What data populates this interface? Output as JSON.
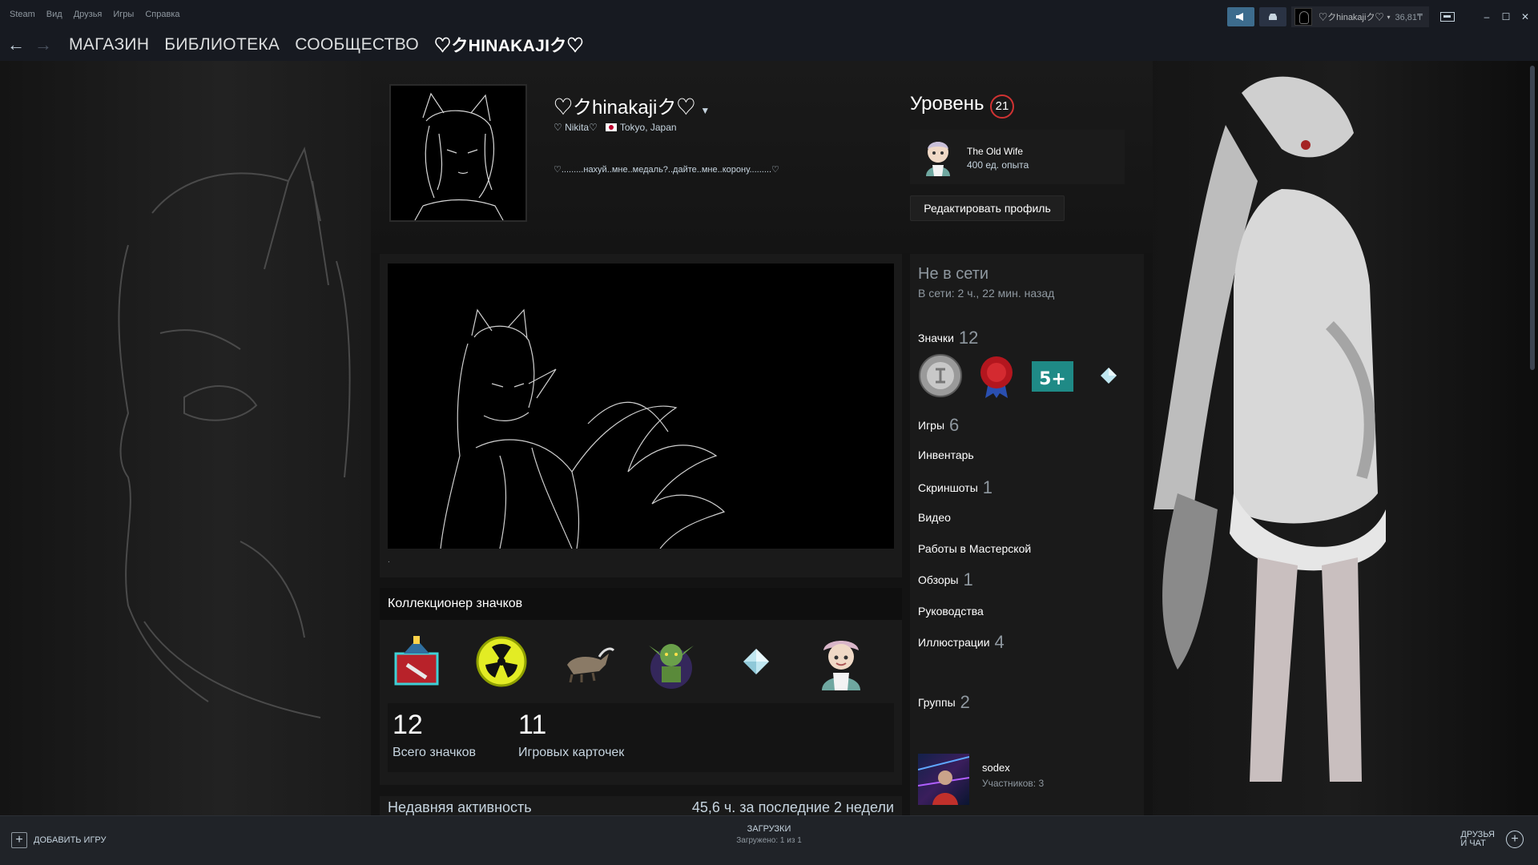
{
  "menu": [
    "Steam",
    "Вид",
    "Друзья",
    "Игры",
    "Справка"
  ],
  "account": {
    "name": "♡クhinakajiク♡",
    "balance": "36,81₸"
  },
  "nav": {
    "store": "МАГАЗИН",
    "library": "БИБЛИОТЕКА",
    "community": "СООБЩЕСТВО",
    "user": "♡クHINAKAJIク♡"
  },
  "profile": {
    "name": "♡クhinakajiク♡",
    "real_name": "♡ Nikita♡",
    "location": "Tokyo, Japan",
    "summary": "♡.........нахуй..мне..медаль?..дайте..мне..корону.........♡"
  },
  "level": {
    "label": "Уровень",
    "value": "21"
  },
  "favorite_badge": {
    "name": "The Old Wife",
    "xp": "400 ед. опыта"
  },
  "edit_profile": "Редактировать профиль",
  "showcase_caption": ".",
  "collector": {
    "title": "Коллекционер значков",
    "badges": [
      "toolbox-badge-icon",
      "radiation-badge-icon",
      "goat-badge-icon",
      "goblin-badge-icon",
      "crystal-badge-icon",
      "old-wife-badge-icon"
    ],
    "total_badges": "12",
    "total_badges_label": "Всего значков",
    "game_cards": "11",
    "game_cards_label": "Игровых карточек"
  },
  "recent": {
    "label": "Недавняя активность",
    "hours": "45,6 ч. за последние 2 недели"
  },
  "sidebar": {
    "status": "Не в сети",
    "last_online": "В сети: 2 ч., 22 мин. назад",
    "badges_label": "Значки",
    "badges_count": "12",
    "games_label": "Игры",
    "games_count": "6",
    "inventory": "Инвентарь",
    "screenshots_label": "Скриншоты",
    "screenshots_count": "1",
    "videos": "Видео",
    "workshop": "Работы в Мастерской",
    "reviews_label": "Обзоры",
    "reviews_count": "1",
    "guides": "Руководства",
    "artwork_label": "Иллюстрации",
    "artwork_count": "4",
    "groups_label": "Группы",
    "groups_count": "2",
    "group": {
      "name": "sodex",
      "members": "Участников: 3"
    }
  },
  "bottom": {
    "add_game": "ДОБАВИТЬ ИГРУ",
    "downloads": "ЗАГРУЗКИ",
    "downloads_status": "Загружено: 1 из 1",
    "friends_line1": "ДРУЗЬЯ",
    "friends_line2": "И ЧАТ"
  },
  "colors": {
    "level_ring": "#d03232",
    "accent": "#3d6c8d",
    "bar": "#171a21"
  }
}
